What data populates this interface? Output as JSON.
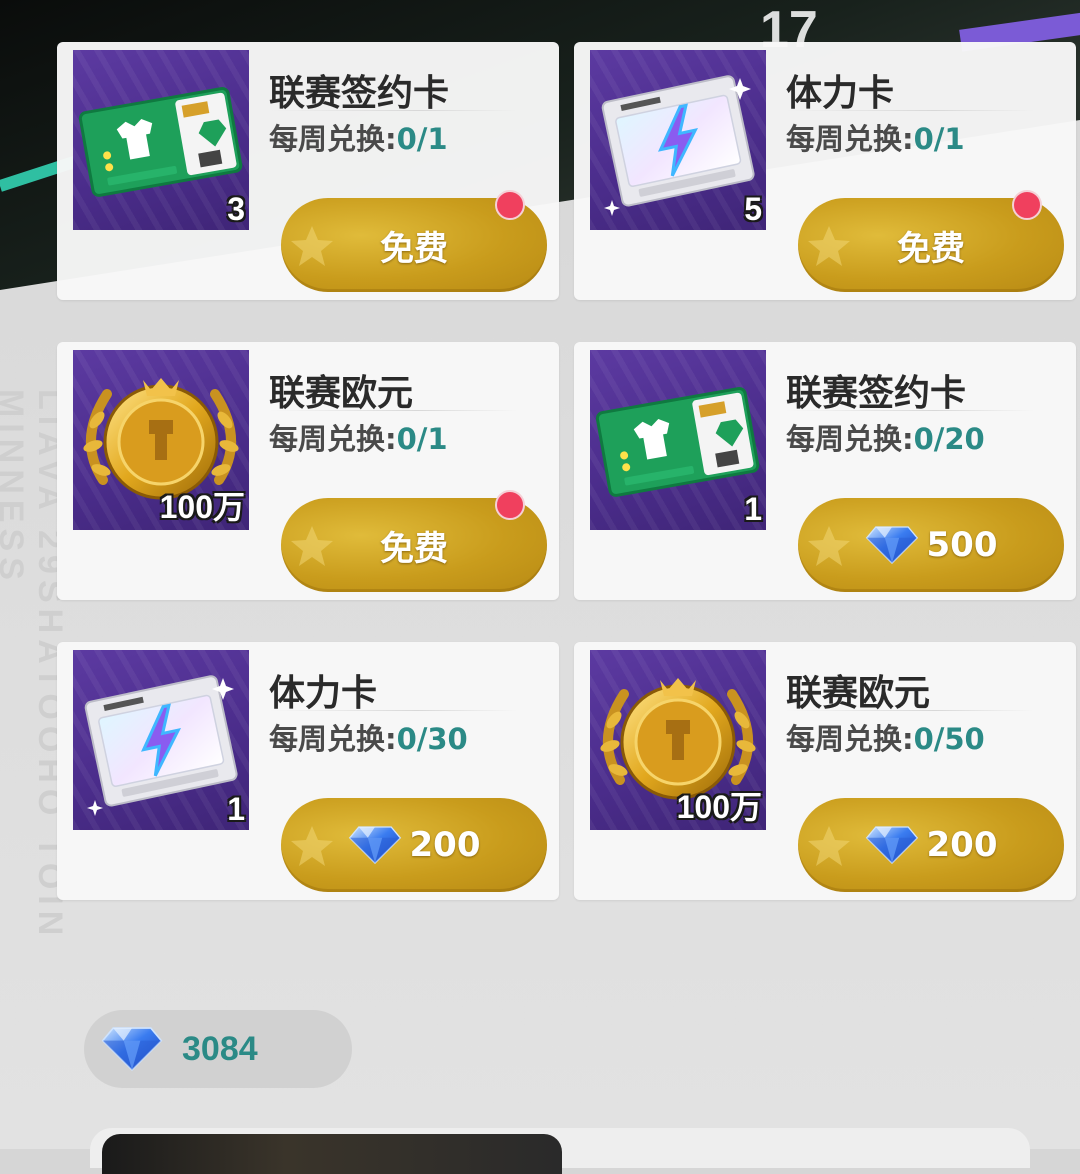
{
  "colors": {
    "accent_teal": "#2b8a86",
    "button_gold": "#c99c1c",
    "badge_red": "#f0405e",
    "thumb_purple": "#4a2c8a"
  },
  "header": {
    "jersey_number": "17"
  },
  "watermark": "LIAVA 29SHATOOHO TOIN MINNESS",
  "items": [
    {
      "icon": "league-contract-card-icon",
      "quantity": "3",
      "title": "联赛签约卡",
      "limit_label": "每周兑换:",
      "limit_value": "0/1",
      "price": "免费",
      "price_icon": "",
      "notification": true
    },
    {
      "icon": "stamina-card-icon",
      "quantity": "5",
      "title": "体力卡",
      "limit_label": "每周兑换:",
      "limit_value": "0/1",
      "price": "免费",
      "price_icon": "",
      "notification": true
    },
    {
      "icon": "league-euro-medal-icon",
      "quantity": "100万",
      "title": "联赛欧元",
      "limit_label": "每周兑换:",
      "limit_value": "0/1",
      "price": "免费",
      "price_icon": "",
      "notification": true
    },
    {
      "icon": "league-contract-card-icon",
      "quantity": "1",
      "title": "联赛签约卡",
      "limit_label": "每周兑换:",
      "limit_value": "0/20",
      "price": "500",
      "price_icon": "diamond-icon",
      "notification": false
    },
    {
      "icon": "stamina-card-icon",
      "quantity": "1",
      "title": "体力卡",
      "limit_label": "每周兑换:",
      "limit_value": "0/30",
      "price": "200",
      "price_icon": "diamond-icon",
      "notification": false
    },
    {
      "icon": "league-euro-medal-icon",
      "quantity": "100万",
      "title": "联赛欧元",
      "limit_label": "每周兑换:",
      "limit_value": "0/50",
      "price": "200",
      "price_icon": "diamond-icon",
      "notification": false
    }
  ],
  "wallet": {
    "icon": "diamond-icon",
    "amount": "3084"
  }
}
